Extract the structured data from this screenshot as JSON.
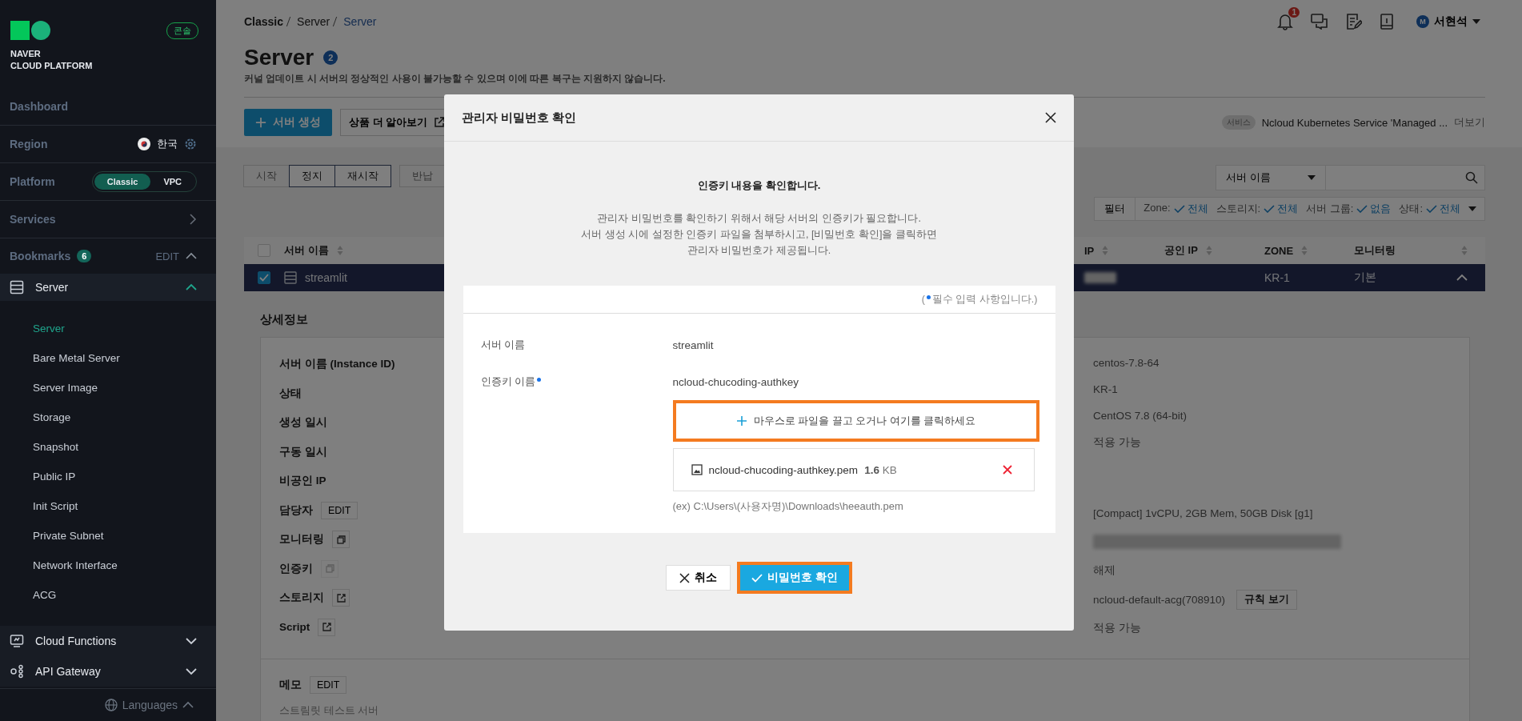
{
  "sidebar": {
    "logo": {
      "line1": "NAVER",
      "line2": "CLOUD PLATFORM"
    },
    "console_badge": "콘솔",
    "dashboard": "Dashboard",
    "region": {
      "label": "Region",
      "value": "한국"
    },
    "platform": {
      "label": "Platform",
      "options": [
        {
          "label": "Classic",
          "selected": true
        },
        {
          "label": "VPC",
          "selected": false
        }
      ]
    },
    "services": "Services",
    "bookmarks": {
      "label": "Bookmarks",
      "count": "6",
      "edit": "EDIT"
    },
    "menu": [
      {
        "label": "Server",
        "expanded": true,
        "children": [
          {
            "label": "Server",
            "selected": true
          },
          {
            "label": "Bare Metal Server",
            "selected": false
          },
          {
            "label": "Server Image",
            "selected": false
          },
          {
            "label": "Storage",
            "selected": false
          },
          {
            "label": "Snapshot",
            "selected": false
          },
          {
            "label": "Public IP",
            "selected": false
          },
          {
            "label": "Init Script",
            "selected": false
          },
          {
            "label": "Private Subnet",
            "selected": false
          },
          {
            "label": "Network Interface",
            "selected": false
          },
          {
            "label": "ACG",
            "selected": false
          }
        ]
      },
      {
        "label": "Cloud Functions",
        "expanded": false
      },
      {
        "label": "API Gateway",
        "expanded": false
      }
    ],
    "languages": "Languages"
  },
  "header": {
    "breadcrumb": [
      "Classic",
      "Server",
      "Server"
    ],
    "notifications": "1",
    "user_initial": "M",
    "user_name": "서현석"
  },
  "page": {
    "title": "Server",
    "count": "2",
    "notice": "커널 업데이트 시 서버의 정상적인 사용이 불가능할 수 있으며 이에 따른 복구는 지원하지 않습니다.",
    "create_button": "서버 생성",
    "learn_more": "상품 더 알아보기",
    "service_notice": {
      "tag": "서비스",
      "text": "Ncloud Kubernetes Service 'Managed ...",
      "more": "더보기"
    }
  },
  "actions": [
    {
      "label": "시작",
      "disabled": true
    },
    {
      "label": "정지",
      "disabled": false
    },
    {
      "label": "재시작",
      "disabled": false
    },
    {
      "label": "반납",
      "disabled": true
    }
  ],
  "search": {
    "select": "서버 이름"
  },
  "filter": {
    "button": "필터",
    "items": [
      {
        "label": "Zone:",
        "value": "전체"
      },
      {
        "label": "스토리지:",
        "value": "전체"
      },
      {
        "label": "서버 그룹:",
        "value": "없음"
      },
      {
        "label": "상태:",
        "value": "전체"
      }
    ]
  },
  "table": {
    "all_checked": false,
    "columns": [
      "서버 이름",
      "IP",
      "공인 IP",
      "ZONE",
      "모니터링"
    ],
    "rows": [
      {
        "checked": true,
        "expanded": true,
        "name": "streamlit",
        "zone": "KR-1",
        "monitoring": "기본"
      }
    ]
  },
  "details": {
    "title": "상세정보",
    "labels": [
      {
        "kind": "plain",
        "label": "서버 이름 (Instance ID)"
      },
      {
        "kind": "plain",
        "label": "상태"
      },
      {
        "kind": "plain",
        "label": "생성 일시"
      },
      {
        "kind": "plain",
        "label": "구동 일시"
      },
      {
        "kind": "plain",
        "label": "비공인 IP"
      },
      {
        "kind": "edit",
        "label": "담당자",
        "action": "EDIT"
      },
      {
        "kind": "copy",
        "label": "모니터링",
        "disabled": false
      },
      {
        "kind": "copy",
        "label": "인증키",
        "disabled": true
      },
      {
        "kind": "link",
        "label": "스토리지"
      },
      {
        "kind": "link",
        "label": "Script"
      }
    ],
    "values_top": [
      "centos-7.8-64",
      "KR-1",
      "CentOS 7.8 (64-bit)",
      "적용 가능"
    ],
    "values_bottom": [
      {
        "kind": "text",
        "text": "[Compact] 1vCPU, 2GB Mem, 50GB Disk [g1]"
      },
      {
        "kind": "redacted"
      },
      {
        "kind": "text",
        "text": "해제"
      },
      {
        "kind": "action",
        "text": "ncloud-default-acg(708910)",
        "action": "규칙 보기"
      },
      {
        "kind": "text",
        "text": "적용 가능"
      }
    ],
    "memo": {
      "label": "메모",
      "action": "EDIT",
      "text": "스트림릿 테스트 서버"
    }
  },
  "modal": {
    "title": "관리자 비밀번호 확인",
    "heading": "인증키 내용을 확인합니다.",
    "description": "관리자 비밀번호를 확인하기 위해서 해당 서버의 인증키가 필요합니다.\n서버 생성 시에 설정한 인증키 파일을 첨부하시고, [비밀번호 확인]을 클릭하면\n관리자 비밀번호가 제공됩니다.",
    "required_open": "(",
    "required_note": "필수 입력 사항입니다.)",
    "fields": [
      {
        "label": "서버 이름",
        "value": "streamlit",
        "required": false
      },
      {
        "label": "인증키 이름",
        "value": "ncloud-chucoding-authkey",
        "required": true
      }
    ],
    "dropzone": {
      "text": "마우스로 파일을 끌고 오거나 여기를 클릭하세요",
      "highlighted": true
    },
    "file": {
      "name": "ncloud-chucoding-authkey.pem",
      "size": "1.6",
      "unit": "KB"
    },
    "example": "(ex) C:\\Users\\(사용자명)\\Downloads\\heeauth.pem",
    "cancel": "취소",
    "confirm": {
      "label": "비밀번호 확인",
      "highlighted": true
    }
  }
}
